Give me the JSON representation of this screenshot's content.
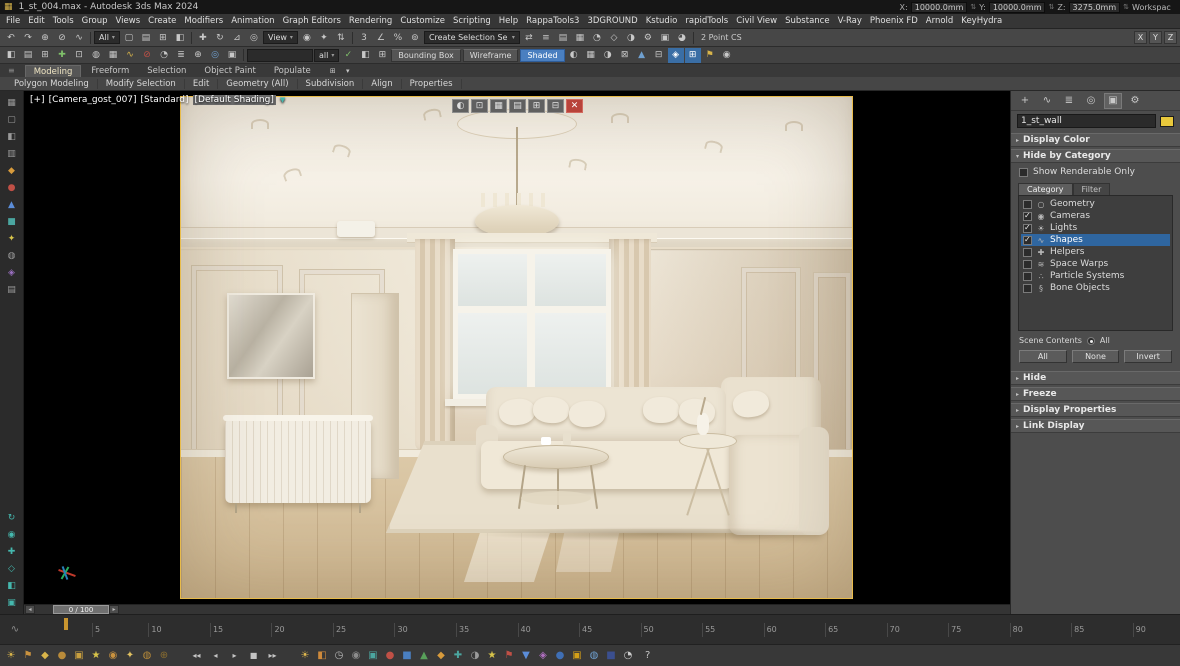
{
  "glyphs": {
    "app_icon": "▦",
    "dropdown_arrow": "▾",
    "rollout_open": "▾",
    "rollout_closed": "▸",
    "slider_left": "◂",
    "slider_right": "▸",
    "close": "✕",
    "funnel": "▼",
    "grip": "≡",
    "ruler_wave": "∿",
    "spinner": "⇅"
  },
  "titlebar": {
    "title": "1_st_004.max - Autodesk 3ds Max 2024",
    "x_label": "X:",
    "x_value": "10000.0mm",
    "y_label": "Y:",
    "y_value": "10000.0mm",
    "z_label": "Z:",
    "z_value": "3275.0mm",
    "workspace": "Workspac"
  },
  "menubar": {
    "items": [
      "File",
      "Edit",
      "Tools",
      "Group",
      "Views",
      "Create",
      "Modifiers",
      "Animation",
      "Graph Editors",
      "Rendering",
      "Customize",
      "Scripting",
      "Help",
      "RappaTools3",
      "3DGROUND",
      "Kstudio",
      "rapidTools",
      "Civil View",
      "Substance",
      "V-Ray",
      "Phoenix FD",
      "Arnold",
      "KeyHydra"
    ]
  },
  "toolbar_main": {
    "icons_left": [
      {
        "glyph": "↶",
        "name": "undo-icon"
      },
      {
        "glyph": "↷",
        "name": "redo-icon"
      },
      {
        "glyph": "⊕",
        "name": "select-and-link-icon"
      },
      {
        "glyph": "⊘",
        "name": "unlink-selection-icon"
      },
      {
        "glyph": "∿",
        "name": "bind-to-space-warp-icon"
      }
    ],
    "selection_filter": "All",
    "icons_sel": [
      {
        "glyph": "▢",
        "name": "select-object-icon"
      },
      {
        "glyph": "▤",
        "name": "select-by-name-icon"
      },
      {
        "glyph": "⊞",
        "name": "rectangular-selection-region-icon"
      },
      {
        "glyph": "◧",
        "name": "window-crossing-icon"
      }
    ],
    "icons_xform": [
      {
        "glyph": "✚",
        "name": "select-and-move-icon"
      },
      {
        "glyph": "↻",
        "name": "select-and-rotate-icon"
      },
      {
        "glyph": "⊿",
        "name": "select-and-scale-icon"
      },
      {
        "glyph": "◎",
        "name": "select-and-place-icon"
      }
    ],
    "ref_coord": "View",
    "icons_center": [
      {
        "glyph": "◉",
        "name": "use-pivot-center-icon"
      },
      {
        "glyph": "✦",
        "name": "select-and-manipulate-icon"
      },
      {
        "glyph": "⇅",
        "name": "keyboard-override-icon"
      }
    ],
    "icons_snap": [
      {
        "glyph": "3",
        "name": "snap-toggle-icon"
      },
      {
        "glyph": "∠",
        "name": "angle-snap-icon"
      },
      {
        "glyph": "%",
        "name": "percent-snap-icon"
      },
      {
        "glyph": "⊚",
        "name": "spinner-snap-icon"
      }
    ],
    "named_sets": "Create Selection Se",
    "icons_right": [
      {
        "glyph": "⇄",
        "name": "mirror-icon"
      },
      {
        "glyph": "≡",
        "name": "align-icon"
      },
      {
        "glyph": "▤",
        "name": "layer-manager-icon"
      },
      {
        "glyph": "▦",
        "name": "ribbon-toggle-icon"
      },
      {
        "glyph": "◔",
        "name": "curve-editor-icon"
      },
      {
        "glyph": "◇",
        "name": "schematic-view-icon"
      },
      {
        "glyph": "◑",
        "name": "material-editor-icon"
      },
      {
        "glyph": "⚙",
        "name": "render-setup-icon"
      },
      {
        "glyph": "▣",
        "name": "rendered-frame-window-icon"
      },
      {
        "glyph": "◕",
        "name": "render-production-icon"
      }
    ],
    "cs_label": "2 Point CS",
    "axis_buttons": [
      "X",
      "Y",
      "Z"
    ]
  },
  "toolbar_custom": {
    "icons_a": [
      {
        "glyph": "◧",
        "name": "viewport-config-icon"
      },
      {
        "glyph": "▤",
        "name": "layer-list-icon"
      },
      {
        "glyph": "⊞",
        "name": "grid-toggle-icon"
      },
      {
        "glyph": "✚",
        "name": "add-object-icon",
        "css": "color:#7fc06a"
      },
      {
        "glyph": "⊡",
        "name": "region-render-icon"
      },
      {
        "glyph": "◍",
        "name": "sphere-icon"
      },
      {
        "glyph": "▦",
        "name": "tiles-icon"
      },
      {
        "glyph": "∿",
        "name": "spline-tool-icon",
        "css": "color:#d8b44a"
      },
      {
        "glyph": "⊘",
        "name": "disable-icon",
        "css": "color:#c05046"
      },
      {
        "glyph": "◔",
        "name": "time-config-icon"
      },
      {
        "glyph": "≣",
        "name": "stack-icon"
      },
      {
        "glyph": "⊕",
        "name": "pivot-icon"
      },
      {
        "glyph": "◎",
        "name": "target-icon",
        "css": "color:#6fa0d0"
      },
      {
        "glyph": "▣",
        "name": "render-box-icon"
      }
    ],
    "dropdown": "all",
    "icons_b": [
      {
        "glyph": "✓",
        "name": "check-icon",
        "css": "color:#7fc06a"
      },
      {
        "glyph": "◧",
        "name": "half-shade-icon"
      },
      {
        "glyph": "⊞",
        "name": "expand-grid-icon"
      }
    ],
    "shading_modes": [
      {
        "label": "Bounding Box",
        "active": false
      },
      {
        "label": "Wireframe",
        "active": false
      },
      {
        "label": "Shaded",
        "active": true
      }
    ],
    "icons_c": [
      {
        "glyph": "◐",
        "name": "shade-half-icon"
      },
      {
        "glyph": "▦",
        "name": "wire-grid-icon"
      },
      {
        "glyph": "◑",
        "name": "material-preview-icon"
      },
      {
        "glyph": "⊠",
        "name": "clip-icon"
      },
      {
        "glyph": "▲",
        "name": "up-arrow-icon",
        "css": "color:#6fa0d0"
      },
      {
        "glyph": "⊟",
        "name": "collapse-icon"
      },
      {
        "glyph": "◈",
        "name": "gem-icon",
        "css": "background:#3a6ea5;color:#fff"
      },
      {
        "glyph": "⊞",
        "name": "grid-active-icon",
        "css": "background:#3a6ea5;color:#fff"
      },
      {
        "glyph": "⚑",
        "name": "flag-icon",
        "css": "color:#d8b44a"
      },
      {
        "glyph": "◉",
        "name": "dot-icon"
      }
    ]
  },
  "ribbon": {
    "tabs": [
      {
        "label": "Modeling",
        "active": true
      },
      {
        "label": "Freeform",
        "active": false
      },
      {
        "label": "Selection",
        "active": false
      },
      {
        "label": "Object Paint",
        "active": false
      },
      {
        "label": "Populate",
        "active": false
      }
    ],
    "extra_icons": [
      {
        "glyph": "⊞",
        "name": "ribbon-expand-icon"
      },
      {
        "glyph": "▾",
        "name": "ribbon-minimize-icon"
      }
    ],
    "panels": [
      "Polygon Modeling",
      "Modify Selection",
      "Edit",
      "Geometry (All)",
      "Subdivision",
      "Align",
      "Properties"
    ]
  },
  "left_toolbar": {
    "icons_top": [
      {
        "glyph": "▦",
        "name": "layout-grid-icon"
      },
      {
        "glyph": "▢",
        "name": "marquee-icon"
      },
      {
        "glyph": "◧",
        "name": "split-view-icon"
      },
      {
        "glyph": "▥",
        "name": "rows-icon"
      },
      {
        "glyph": "◆",
        "name": "orange-diamond-icon",
        "css": "color:#d89b3c"
      },
      {
        "glyph": "●",
        "name": "red-sphere-icon",
        "css": "color:#c05046"
      },
      {
        "glyph": "▲",
        "name": "blue-triangle-icon",
        "css": "color:#5b8dd9"
      },
      {
        "glyph": "■",
        "name": "teal-square-icon",
        "css": "color:#4ba6a0"
      },
      {
        "glyph": "✦",
        "name": "star-icon",
        "css": "color:#d8c44a"
      },
      {
        "glyph": "◍",
        "name": "disc-icon"
      },
      {
        "glyph": "◈",
        "name": "purple-gem-icon",
        "css": "color:#9a6fc0"
      },
      {
        "glyph": "▤",
        "name": "list-icon"
      }
    ],
    "icons_bottom": [
      {
        "glyph": "↻",
        "name": "refresh-icon",
        "css": "color:#45b8ae"
      },
      {
        "glyph": "◉",
        "name": "target-ring-icon",
        "css": "color:#45b8ae"
      },
      {
        "glyph": "✚",
        "name": "plus-icon",
        "css": "color:#45b8ae"
      },
      {
        "glyph": "◇",
        "name": "outline-diamond-icon",
        "css": "color:#45b8ae"
      },
      {
        "glyph": "◧",
        "name": "panel-icon",
        "css": "color:#45b8ae"
      },
      {
        "glyph": "▣",
        "name": "boxed-icon",
        "css": "color:#45b8ae"
      }
    ]
  },
  "viewport": {
    "label_pre": "[+]",
    "label_camera": "[Camera_gost_007]",
    "label_renderer": "[Standard]",
    "label_shading": "[Default Shading]",
    "float_icons": [
      {
        "glyph": "◐",
        "name": "safe-frame-icon"
      },
      {
        "glyph": "⊡",
        "name": "region-icon"
      },
      {
        "glyph": "▦",
        "name": "grid-icon"
      },
      {
        "glyph": "▤",
        "name": "layers-icon"
      },
      {
        "glyph": "⊞",
        "name": "tile-icon"
      },
      {
        "glyph": "⊟",
        "name": "minimize-icon"
      }
    ]
  },
  "command_panel": {
    "tabs": [
      {
        "glyph": "+",
        "name": "create-tab-icon",
        "active": false
      },
      {
        "glyph": "∿",
        "name": "modify-tab-icon",
        "active": false
      },
      {
        "glyph": "≣",
        "name": "hierarchy-tab-icon",
        "active": false
      },
      {
        "glyph": "◎",
        "name": "motion-tab-icon",
        "active": false
      },
      {
        "glyph": "▣",
        "name": "display-tab-icon",
        "active": true
      },
      {
        "glyph": "⚙",
        "name": "utilities-tab-icon",
        "active": false
      }
    ],
    "object_name": "1_st_wall",
    "rollout_display_color": "Display Color",
    "rollout_hide_by_category": "Hide by Category",
    "show_renderable": "Show Renderable Only",
    "list_tabs": [
      {
        "label": "Category",
        "active": true
      },
      {
        "label": "Filter",
        "active": false
      }
    ],
    "categories": [
      {
        "label": "Geometry",
        "icon": "○",
        "checked": false,
        "selected": false
      },
      {
        "label": "Cameras",
        "icon": "◉",
        "checked": true,
        "selected": false
      },
      {
        "label": "Lights",
        "icon": "☀",
        "checked": true,
        "selected": false
      },
      {
        "label": "Shapes",
        "icon": "∿",
        "checked": true,
        "selected": true
      },
      {
        "label": "Helpers",
        "icon": "✚",
        "checked": false,
        "selected": false
      },
      {
        "label": "Space Warps",
        "icon": "≋",
        "checked": false,
        "selected": false
      },
      {
        "label": "Particle Systems",
        "icon": "∴",
        "checked": false,
        "selected": false
      },
      {
        "label": "Bone Objects",
        "icon": "§",
        "checked": false,
        "selected": false
      }
    ],
    "scene_contents_label": "Scene Contents",
    "scene_contents_all": "All",
    "buttons": [
      "All",
      "None",
      "Invert"
    ],
    "bottom_rollouts": [
      "Hide",
      "Freeze",
      "Display Properties",
      "Link Display"
    ]
  },
  "timeline": {
    "thumb_label": "0 / 100",
    "ticks": [
      "5",
      "10",
      "15",
      "20",
      "25",
      "30",
      "35",
      "40",
      "45",
      "50",
      "55",
      "60",
      "65",
      "70",
      "75",
      "80",
      "85",
      "90"
    ]
  },
  "statusbar": {
    "left_icons": [
      {
        "glyph": "☀",
        "name": "sun-icon",
        "css": "color:#d8b44a"
      },
      {
        "glyph": "⚑",
        "name": "flag-icon",
        "css": "color:#c9923f"
      },
      {
        "glyph": "◆",
        "name": "diamond-icon",
        "css": "color:#d8b44a"
      },
      {
        "glyph": "●",
        "name": "dot-icon",
        "css": "color:#b98b3a"
      },
      {
        "glyph": "▣",
        "name": "box-icon",
        "css": "color:#c9a03f"
      },
      {
        "glyph": "★",
        "name": "star-icon",
        "css": "color:#d8c44a"
      },
      {
        "glyph": "◉",
        "name": "ring-icon",
        "css": "color:#c9923f"
      },
      {
        "glyph": "✦",
        "name": "spark-icon",
        "css": "color:#e0c060"
      },
      {
        "glyph": "◍",
        "name": "disc-icon",
        "css": "color:#b98b3a"
      },
      {
        "glyph": "⊕",
        "name": "plus-circle-icon",
        "css": "color:#8a6d2f"
      }
    ],
    "transport": [
      {
        "glyph": "◂◂",
        "name": "go-to-start-icon"
      },
      {
        "glyph": "◂",
        "name": "previous-frame-icon"
      },
      {
        "glyph": "▸",
        "name": "play-icon"
      },
      {
        "glyph": "■",
        "name": "stop-icon"
      },
      {
        "glyph": "▸▸",
        "name": "go-to-end-icon"
      }
    ],
    "right_icons": [
      {
        "glyph": "☀",
        "name": "sun2-icon",
        "css": "color:#e0b84e"
      },
      {
        "glyph": "◧",
        "name": "half-icon",
        "css": "color:#cf8a3b"
      },
      {
        "glyph": "◷",
        "name": "clock-icon",
        "css": "color:#b8b8b8"
      },
      {
        "glyph": "◉",
        "name": "camera-icon",
        "css": "color:#8c8c8c"
      },
      {
        "glyph": "▣",
        "name": "teal-box-icon",
        "css": "color:#4ba6a0"
      },
      {
        "glyph": "●",
        "name": "red-dot-icon",
        "css": "color:#c05046"
      },
      {
        "glyph": "■",
        "name": "blue-box-icon",
        "css": "color:#4a7fc0"
      },
      {
        "glyph": "▲",
        "name": "green-triangle-icon",
        "css": "color:#58a05a"
      },
      {
        "glyph": "◆",
        "name": "orange-diamond-icon",
        "css": "color:#d89b3c"
      },
      {
        "glyph": "✚",
        "name": "teal-plus-icon",
        "css": "color:#4ba6a0"
      },
      {
        "glyph": "◑",
        "name": "material-icon",
        "css": "color:#9a9a9a"
      },
      {
        "glyph": "★",
        "name": "gold-star-icon",
        "css": "color:#d8c44a"
      },
      {
        "glyph": "⚑",
        "name": "red-flag-icon",
        "css": "color:#c05046"
      },
      {
        "glyph": "▼",
        "name": "down-icon",
        "css": "color:#5b8dd9"
      },
      {
        "glyph": "◈",
        "name": "purple-icon",
        "css": "color:#b06fc0"
      },
      {
        "glyph": "●",
        "name": "blue-dot-icon",
        "css": "color:#3f6fb5"
      },
      {
        "glyph": "▣",
        "name": "gold-box-icon",
        "css": "color:#d4a017"
      },
      {
        "glyph": "◍",
        "name": "disc2-icon",
        "css": "color:#6fa0d0"
      },
      {
        "glyph": "■",
        "name": "navy-box-icon",
        "css": "color:#3b4f8f"
      },
      {
        "glyph": "◔",
        "name": "timer-icon",
        "css": "color:#cccccc"
      }
    ],
    "help_glyph": "?"
  }
}
